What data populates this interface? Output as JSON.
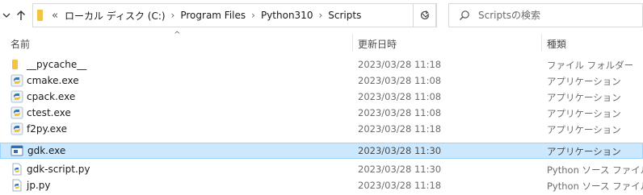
{
  "nav": {
    "recent_icon": "chevron-down-icon",
    "up_icon": "arrow-up-icon"
  },
  "address": {
    "overflow_chevron": "«",
    "crumbs": [
      "ローカル ディスク (C:)",
      "Program Files",
      "Python310",
      "Scripts"
    ]
  },
  "search": {
    "placeholder": "Scriptsの検索"
  },
  "columns": {
    "name": "名前",
    "date": "更新日時",
    "type": "種類"
  },
  "files": [
    {
      "name": "__pycache__",
      "date": "2023/03/28 11:18",
      "type": "ファイル フォルダー",
      "icon": "folder-icon",
      "selected": false
    },
    {
      "name": "cmake.exe",
      "date": "2023/03/28 11:08",
      "type": "アプリケーション",
      "icon": "python-exe-icon",
      "selected": false
    },
    {
      "name": "cpack.exe",
      "date": "2023/03/28 11:08",
      "type": "アプリケーション",
      "icon": "python-exe-icon",
      "selected": false
    },
    {
      "name": "ctest.exe",
      "date": "2023/03/28 11:08",
      "type": "アプリケーション",
      "icon": "python-exe-icon",
      "selected": false
    },
    {
      "name": "f2py.exe",
      "date": "2023/03/28 11:18",
      "type": "アプリケーション",
      "icon": "python-exe-icon",
      "selected": false
    },
    {
      "name": "gdk.exe",
      "date": "2023/03/28 11:30",
      "type": "アプリケーション",
      "icon": "app-exe-icon",
      "selected": true
    },
    {
      "name": "gdk-script.py",
      "date": "2023/03/28 11:30",
      "type": "Python ソース ファイル",
      "icon": "python-file-icon",
      "selected": false
    },
    {
      "name": "jp.py",
      "date": "2023/03/28 11:18",
      "type": "Python ソース ファイル",
      "icon": "python-file-icon",
      "selected": false
    }
  ],
  "colors": {
    "selection_bg": "#cce8ff",
    "selection_border": "#99d1ff",
    "folder": "#f5c342"
  }
}
